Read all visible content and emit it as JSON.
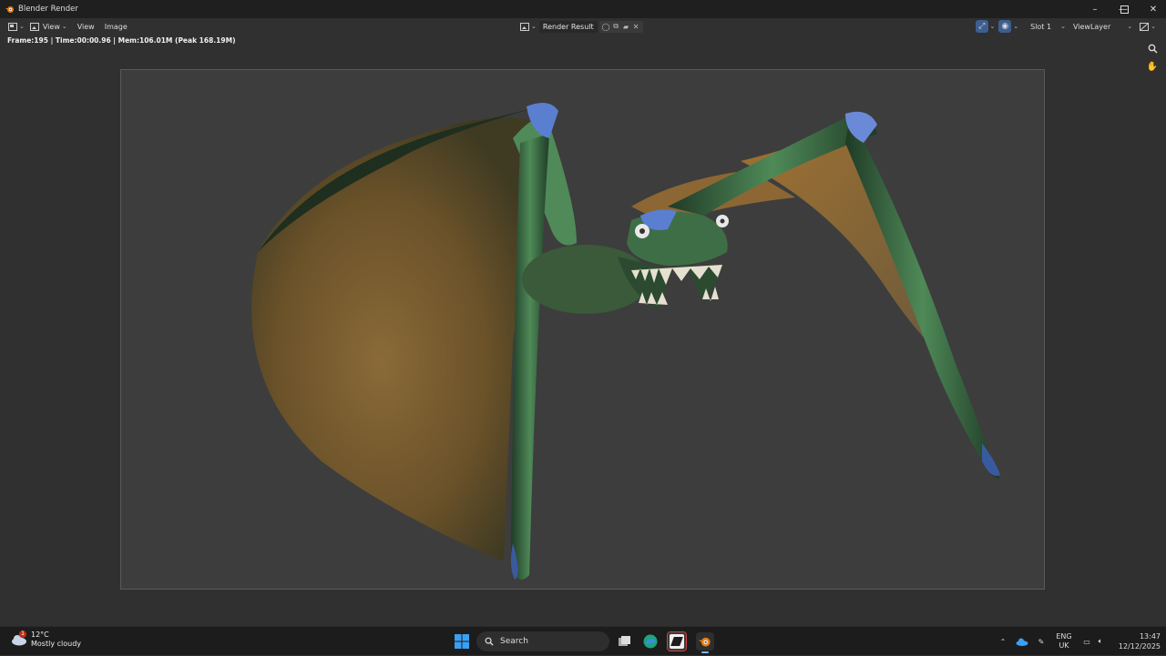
{
  "window": {
    "title": "Blender Render"
  },
  "header": {
    "view_menu_label": "View",
    "menu_view": "View",
    "menu_image": "Image",
    "image_name": "Render Result",
    "slot": "Slot 1",
    "view_layer": "ViewLayer"
  },
  "status": {
    "text": "Frame:195 | Time:00:00.96 | Mem:106.01M (Peak 168.19M)"
  },
  "taskbar": {
    "weather_temp": "12°C",
    "weather_desc": "Mostly cloudy",
    "weather_badge": "1",
    "search_label": "Search",
    "lang_line1": "ENG",
    "lang_line2": "UK",
    "time": "13:47",
    "date": "12/12/2025"
  },
  "colors": {
    "accent": "#4a7fc1",
    "blender_orange": "#e87d0d",
    "wing_membrane": "#8a6a38",
    "dragon_body": "#3e6e46"
  },
  "icons": [
    "blender-logo-icon",
    "editor-type-icon",
    "image-icon",
    "shield-icon",
    "duplicate-icon",
    "folder-icon",
    "close-icon",
    "gizmo-icon",
    "overlay-icon",
    "display-icon",
    "zoom-icon",
    "hand-icon",
    "windows-start-icon",
    "search-icon",
    "task-view-icon",
    "edge-icon",
    "app-icon",
    "blender-icon",
    "chevron-up-icon",
    "onedrive-icon",
    "pen-icon",
    "monitor-icon",
    "speaker-icon"
  ]
}
